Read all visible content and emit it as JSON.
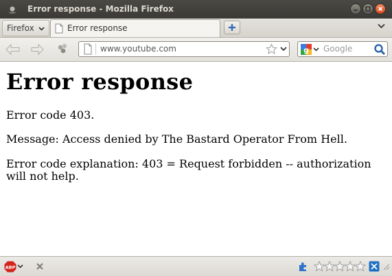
{
  "window": {
    "title": "Error response - Mozilla Firefox"
  },
  "tabbar": {
    "firefox_menu_label": "Firefox",
    "tabs": [
      {
        "label": "Error response",
        "active": true
      }
    ]
  },
  "navbar": {
    "url": "www.youtube.com",
    "search_placeholder": "Google"
  },
  "page": {
    "heading": "Error response",
    "code_line": "Error code 403.",
    "message_line": "Message: Access denied by The Bastard Operator From Hell.",
    "explanation_line": "Error code explanation: 403 = Request forbidden -- authorization will not help."
  },
  "statusbar": {
    "adblock_label": "ABP",
    "rating_stars": 0,
    "rating_max": 5
  },
  "colors": {
    "titlebar": "#3c3b37",
    "close_button": "#e2561f",
    "adblock_red": "#d4251c",
    "search_go_blue": "#2a64a8"
  },
  "icons": {
    "window_icon": "firefox-dot-icon",
    "back": "back-arrow-icon",
    "forward": "forward-arrow-icon",
    "history": "history-icon",
    "page": "page-icon",
    "bookmark": "star-icon",
    "search_engine": "google-icon",
    "search_go": "magnifier-icon",
    "adblock": "adblock-icon",
    "close_status": "close-icon",
    "puzzle": "puzzle-icon",
    "extension": "extension-icon"
  }
}
